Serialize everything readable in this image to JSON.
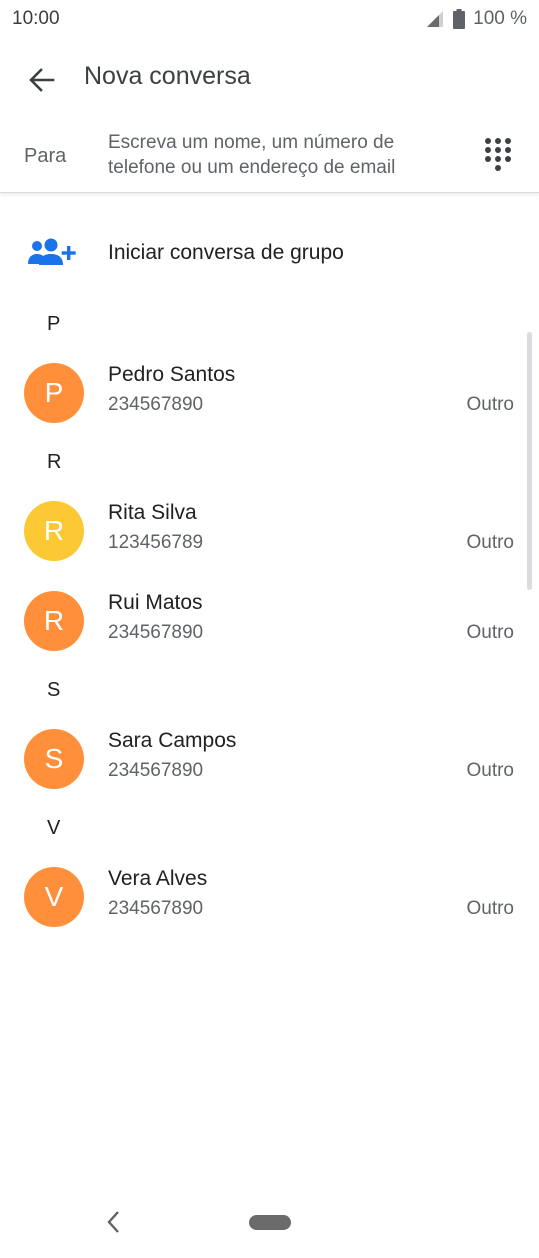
{
  "status_bar": {
    "time": "10:00",
    "battery_text": "100 %"
  },
  "header": {
    "title": "Nova conversa",
    "back_icon": "arrow-back-icon"
  },
  "to_field": {
    "label": "Para",
    "placeholder": "Escreva um nome, um número de telefone ou um endereço de email",
    "dialpad_icon": "dialpad-icon"
  },
  "group_action": {
    "label": "Iniciar conversa de grupo",
    "icon": "group-add-icon",
    "icon_color": "#1a73e8"
  },
  "sections": [
    {
      "letter": "P",
      "contacts": [
        {
          "initial": "P",
          "name": "Pedro Santos",
          "phone": "234567890",
          "type": "Outro",
          "color": "#ff8f3a"
        }
      ]
    },
    {
      "letter": "R",
      "contacts": [
        {
          "initial": "R",
          "name": "Rita Silva",
          "phone": "123456789",
          "type": "Outro",
          "color": "#fcc934"
        },
        {
          "initial": "R",
          "name": "Rui Matos",
          "phone": "234567890",
          "type": "Outro",
          "color": "#ff8f3a"
        }
      ]
    },
    {
      "letter": "S",
      "contacts": [
        {
          "initial": "S",
          "name": "Sara Campos",
          "phone": "234567890",
          "type": "Outro",
          "color": "#ff8f3a"
        }
      ]
    },
    {
      "letter": "V",
      "contacts": [
        {
          "initial": "V",
          "name": "Vera Alves",
          "phone": "234567890",
          "type": "Outro",
          "color": "#ff8f3a"
        }
      ]
    }
  ],
  "nav_bar": {
    "back_icon": "nav-back-icon",
    "home_icon": "home-pill-icon"
  }
}
